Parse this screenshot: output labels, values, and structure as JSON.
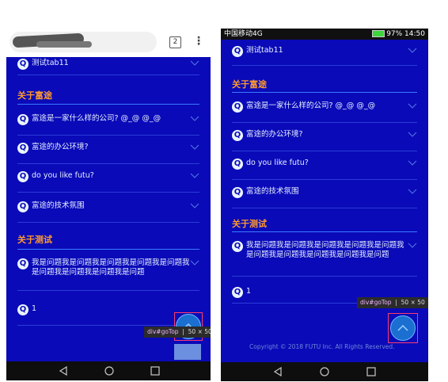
{
  "left_phone": {
    "tab_count": "2",
    "menu_icon": "kebab-icon",
    "section_about": "关于富途",
    "section_test": "关于测试",
    "rows_top": [
      {
        "label": "测试tab11"
      }
    ],
    "rows_about": [
      {
        "label": "富途是一家什么样的公司? @_@ @_@"
      },
      {
        "label": "富途的办公环境?"
      },
      {
        "label": "do you like futu?"
      },
      {
        "label": "富途的技术氛围"
      }
    ],
    "rows_test": [
      {
        "label": "我是问题我是问题我是问题我是问题我是问题我是问题我是问题我是问题我是问题"
      },
      {
        "label": "1"
      }
    ],
    "tooltip_selector": "div#goTop",
    "tooltip_size": "50 × 50",
    "q_letter": "Q"
  },
  "right_phone": {
    "status_left": "中国移动4G",
    "status_right": "97% 14:50",
    "section_about": "关于富途",
    "section_test": "关于测试",
    "rows_top": [
      {
        "label": "测试tab11"
      }
    ],
    "rows_about": [
      {
        "label": "富途是一家什么样的公司? @_@ @_@"
      },
      {
        "label": "富途的办公环境?"
      },
      {
        "label": "do you like futu?"
      },
      {
        "label": "富途的技术氛围"
      }
    ],
    "rows_test": [
      {
        "label": "我是问题我是问题我是问题我是问题我是问题我是问题我是问题我是问题我是问题我是问题"
      },
      {
        "label": "1"
      }
    ],
    "tooltip_selector": "div#goTop",
    "tooltip_size": "50 × 50",
    "copyright": "Copyright © 2018 FUTU Inc. All Rights Reserved.",
    "q_letter": "Q"
  },
  "colors": {
    "page_bg": "#0a0ab8",
    "section_color": "#ff9a2e",
    "row_text": "#e6f0ff"
  }
}
